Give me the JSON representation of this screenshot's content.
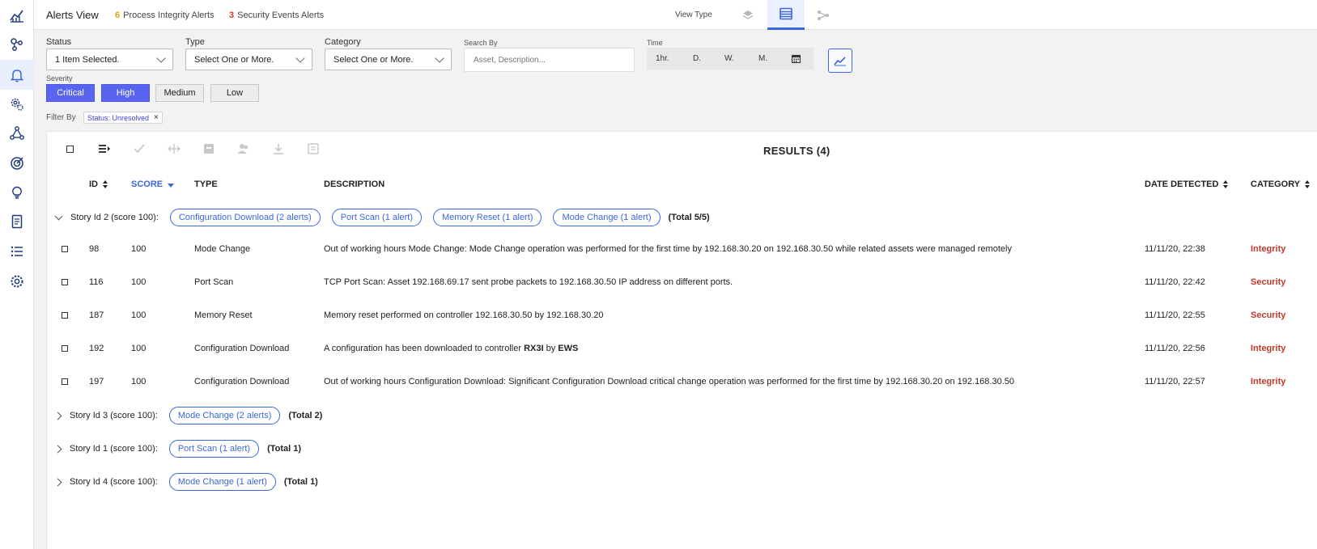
{
  "header": {
    "title": "Alerts View",
    "counts": [
      {
        "n": "6",
        "label": "Process Integrity Alerts",
        "color": "#e0a400"
      },
      {
        "n": "3",
        "label": "Security Events Alerts",
        "color": "#d93a2b"
      }
    ],
    "view_type_label": "View Type"
  },
  "filters": {
    "status": {
      "label": "Status",
      "value": "1 Item Selected."
    },
    "type": {
      "label": "Type",
      "value": "Select One or More."
    },
    "category": {
      "label": "Category",
      "value": "Select One or More."
    },
    "search": {
      "label": "Search By",
      "placeholder": "Asset, Description..."
    },
    "time": {
      "label": "Time",
      "options": [
        "1hr.",
        "D.",
        "W.",
        "M."
      ]
    },
    "severity": {
      "label": "Severity",
      "options": [
        {
          "label": "Critical",
          "selected": true
        },
        {
          "label": "High",
          "selected": true
        },
        {
          "label": "Medium",
          "selected": false
        },
        {
          "label": "Low",
          "selected": false
        }
      ]
    },
    "filter_by": {
      "label": "Filter By",
      "chip": "Status: Unresolved",
      "remove": "×"
    }
  },
  "results": {
    "title": "RESULTS (4)",
    "columns": {
      "id": "ID",
      "score": "SCORE",
      "type": "TYPE",
      "description": "DESCRIPTION",
      "date": "DATE DETECTED",
      "category": "CATEGORY"
    },
    "stories": [
      {
        "label": "Story Id 2 (score 100):",
        "chips": [
          "Configuration Download (2 alerts)",
          "Port Scan (1 alert)",
          "Memory Reset (1 alert)",
          "Mode Change (1 alert)"
        ],
        "total": "(Total 5/5)"
      },
      {
        "label": "Story Id 3 (score 100):",
        "chips": [
          "Mode Change (2 alerts)"
        ],
        "total": "(Total 2)"
      },
      {
        "label": "Story Id 1 (score 100):",
        "chips": [
          "Port Scan (1 alert)"
        ],
        "total": "(Total 1)"
      },
      {
        "label": "Story Id 4 (score 100):",
        "chips": [
          "Mode Change (1 alert)"
        ],
        "total": "(Total 1)"
      }
    ],
    "rows": [
      {
        "id": "98",
        "score": "100",
        "type": "Mode Change",
        "description": "Out of working hours Mode Change: Mode Change operation was performed for the first time by 192.168.30.20 on 192.168.30.50 while related assets were managed remotely",
        "date": "11/11/20, 22:38",
        "category": "Integrity"
      },
      {
        "id": "116",
        "score": "100",
        "type": "Port Scan",
        "description": "TCP Port Scan: Asset 192.168.69.17 sent probe packets to 192.168.30.50 IP address on different ports.",
        "date": "11/11/20, 22:42",
        "category": "Security"
      },
      {
        "id": "187",
        "score": "100",
        "type": "Memory Reset",
        "description": "Memory reset performed on controller 192.168.30.50 by 192.168.30.20",
        "date": "11/11/20, 22:55",
        "category": "Security"
      },
      {
        "id": "192",
        "score": "100",
        "type": "Configuration Download",
        "description_parts": [
          "A configuration has been downloaded to controller ",
          "RX3I",
          " by ",
          "EWS"
        ],
        "date": "11/11/20, 22:56",
        "category": "Integrity"
      },
      {
        "id": "197",
        "score": "100",
        "type": "Configuration Download",
        "description": "Out of working hours Configuration Download: Significant Configuration Download critical change operation was performed for the first time by 192.168.30.20 on 192.168.30.50",
        "date": "11/11/20, 22:57",
        "category": "Integrity"
      }
    ]
  },
  "colors": {
    "accent": "#3b67d9",
    "severity_on": "#5964f0",
    "category_text": "#c0392b"
  },
  "icons": {
    "rail": [
      "analytics-icon",
      "network-icon",
      "bell-icon",
      "gears-icon",
      "topology-icon",
      "target-icon",
      "lightbulb-icon",
      "report-icon",
      "list-icon",
      "settings-icon"
    ],
    "toolbar": [
      "select-all-checkbox",
      "expand-list-icon",
      "resolve-check-icon",
      "merge-icon",
      "archive-icon",
      "assign-user-icon",
      "download-icon",
      "report-icon"
    ]
  }
}
